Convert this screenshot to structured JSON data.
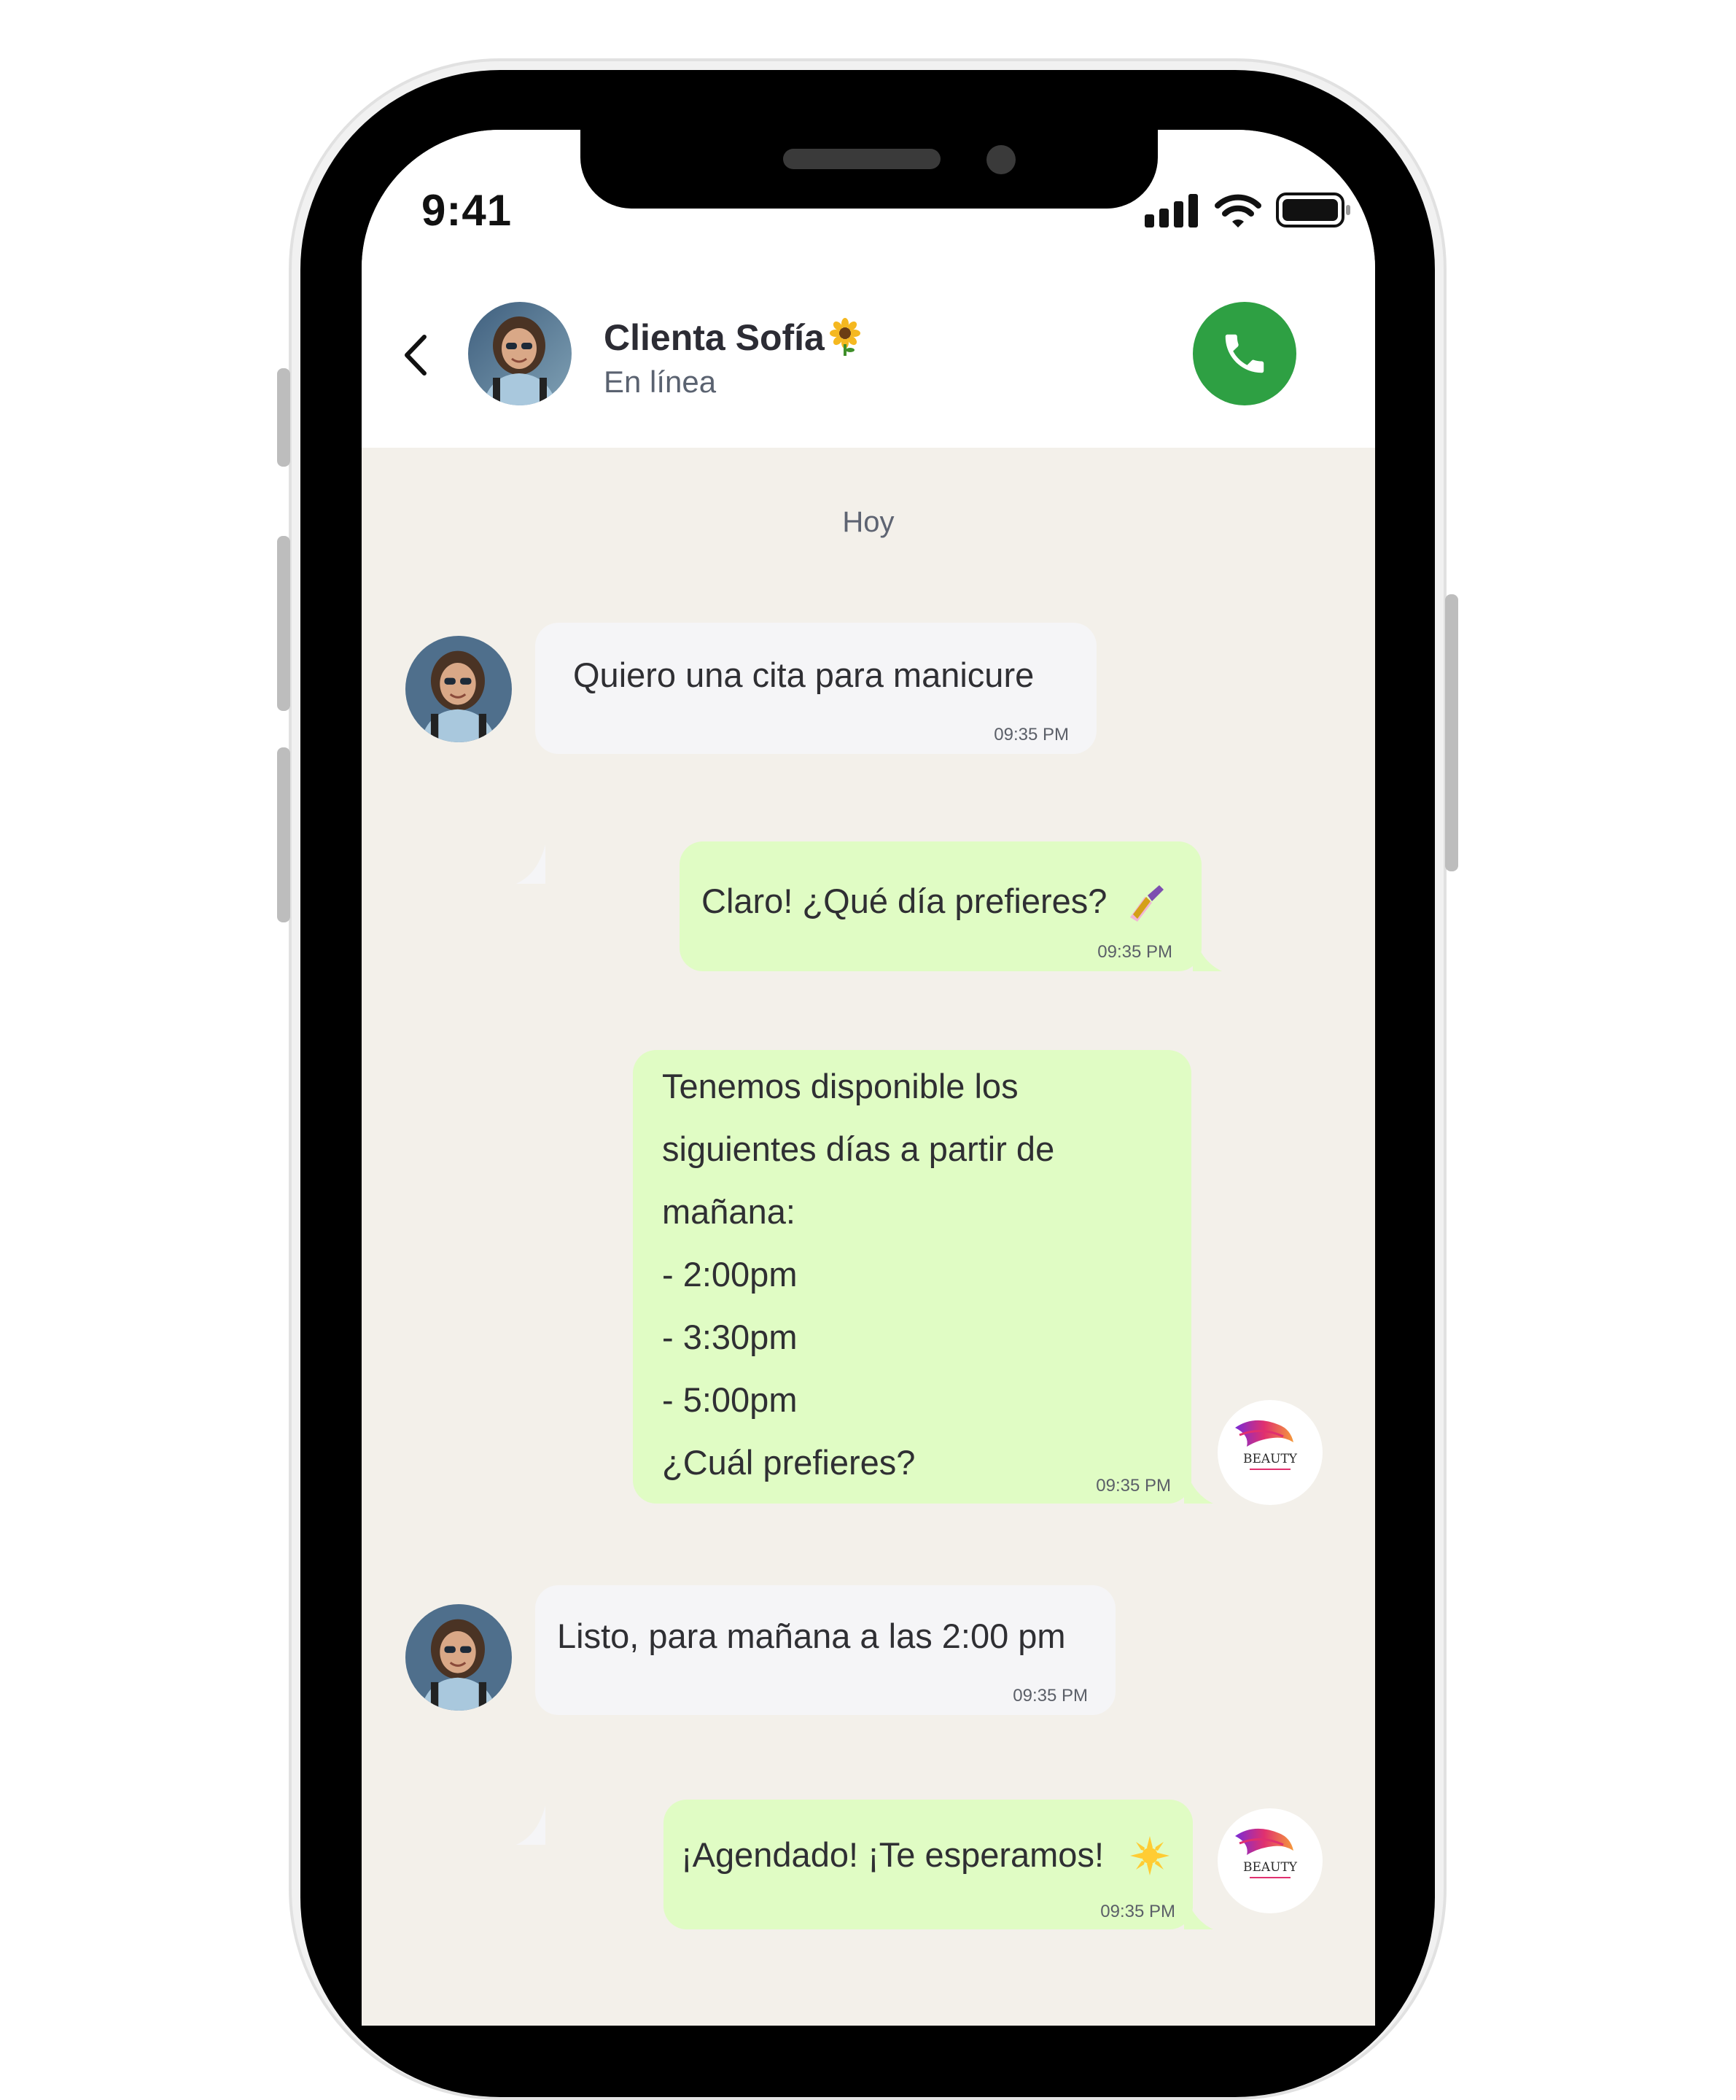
{
  "status_bar": {
    "time": "9:41",
    "signal_icon": "signal-bars-icon",
    "wifi_icon": "wifi-icon",
    "battery_icon": "battery-icon"
  },
  "header": {
    "contact_name": "Clienta Sofía",
    "contact_status": "En línea",
    "name_emoji_icon": "sunflower-icon",
    "back_icon": "chevron-left-icon",
    "call_icon": "phone-icon",
    "call_button_color": "#2ea043"
  },
  "chat": {
    "day_label": "Hoy",
    "messages": [
      {
        "direction": "incoming",
        "text": "Quiero una cita para manicure",
        "time": "09:35 PM"
      },
      {
        "direction": "outgoing",
        "text": "Claro! ¿Qué día prefieres?",
        "time": "09:35 PM",
        "emoji_icon": "nail-polish-icon"
      },
      {
        "direction": "outgoing",
        "lines": [
          "Tenemos disponible los",
          "siguientes días a partir de",
          "mañana:",
          "- 2:00pm",
          "- 3:30pm",
          "- 5:00pm",
          "¿Cuál prefieres?"
        ],
        "time": "09:35 PM"
      },
      {
        "direction": "incoming",
        "text": "Listo, para mañana a las 2:00 pm",
        "time": "09:35 PM"
      },
      {
        "direction": "outgoing",
        "text": "¡Agendado! ¡Te esperamos!",
        "time": "09:35 PM",
        "emoji_icon": "sun-icon"
      }
    ],
    "brand_logo_text": "BEAUTY",
    "incoming_bubble_color": "#f5f5f7",
    "outgoing_bubble_color": "#e0fcc4",
    "chat_background_color": "#f3f0ea"
  }
}
